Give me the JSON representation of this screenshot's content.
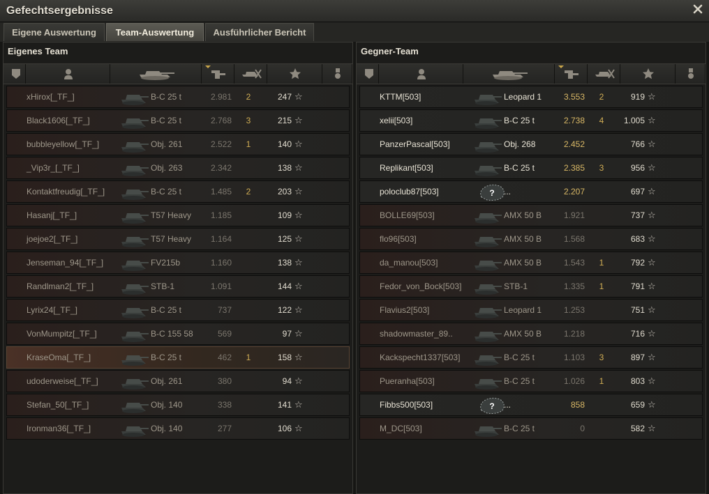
{
  "window": {
    "title": "Gefechtsergebnisse"
  },
  "tabs": [
    {
      "label": "Eigene Auswertung",
      "active": false
    },
    {
      "label": "Team-Auswertung",
      "active": true
    },
    {
      "label": "Ausführlicher Bericht",
      "active": false
    }
  ],
  "icons": {
    "close": "close-icon",
    "columns": [
      "platoon-icon",
      "player-icon",
      "tank-icon",
      "damage-icon",
      "kills-icon",
      "xp-star-icon",
      "medal-icon"
    ],
    "star": "☆",
    "unknown_vehicle": "?"
  },
  "colors": {
    "accent": "#d2ae55",
    "alive_text": "#e9e4d6",
    "dead_text": "#9e978a"
  },
  "own_team": {
    "title": "Eigenes Team",
    "rows": [
      {
        "player": "xHirox[_TF_]",
        "vehicle": "B-C 25 t",
        "damage": "2.981",
        "kills": "2",
        "xp": "247",
        "me": false
      },
      {
        "player": "Black1606[_TF_]",
        "vehicle": "B-C 25 t",
        "damage": "2.768",
        "kills": "3",
        "xp": "215",
        "me": false
      },
      {
        "player": "bubbleyellow[_TF_]",
        "vehicle": "Obj. 261",
        "damage": "2.522",
        "kills": "1",
        "xp": "140",
        "me": false
      },
      {
        "player": "_Vip3r_[_TF_]",
        "vehicle": "Obj. 263",
        "damage": "2.342",
        "kills": "",
        "xp": "138",
        "me": false
      },
      {
        "player": "Kontaktfreudig[_TF_]",
        "vehicle": "B-C 25 t",
        "damage": "1.485",
        "kills": "2",
        "xp": "203",
        "me": false
      },
      {
        "player": "Hasanj[_TF_]",
        "vehicle": "T57 Heavy",
        "damage": "1.185",
        "kills": "",
        "xp": "109",
        "me": false
      },
      {
        "player": "joejoe2[_TF_]",
        "vehicle": "T57 Heavy",
        "damage": "1.164",
        "kills": "",
        "xp": "125",
        "me": false
      },
      {
        "player": "Jenseman_94[_TF_]",
        "vehicle": "FV215b",
        "damage": "1.160",
        "kills": "",
        "xp": "138",
        "me": false
      },
      {
        "player": "Randlman2[_TF_]",
        "vehicle": "STB-1",
        "damage": "1.091",
        "kills": "",
        "xp": "144",
        "me": false
      },
      {
        "player": "Lyrix24[_TF_]",
        "vehicle": "B-C 25 t",
        "damage": "737",
        "kills": "",
        "xp": "122",
        "me": false
      },
      {
        "player": "VonMumpitz[_TF_]",
        "vehicle": "B-C 155 58",
        "damage": "569",
        "kills": "",
        "xp": "97",
        "me": false
      },
      {
        "player": "KraseOma[_TF_]",
        "vehicle": "B-C 25 t",
        "damage": "462",
        "kills": "1",
        "xp": "158",
        "me": true
      },
      {
        "player": "udoderweise[_TF_]",
        "vehicle": "Obj. 261",
        "damage": "380",
        "kills": "",
        "xp": "94",
        "me": false
      },
      {
        "player": "Stefan_50[_TF_]",
        "vehicle": "Obj. 140",
        "damage": "338",
        "kills": "",
        "xp": "141",
        "me": false
      },
      {
        "player": "Ironman36[_TF_]",
        "vehicle": "Obj. 140",
        "damage": "277",
        "kills": "",
        "xp": "106",
        "me": false
      }
    ]
  },
  "enemy_team": {
    "title": "Gegner-Team",
    "rows": [
      {
        "player": "KTTM[503]",
        "vehicle": "Leopard 1",
        "damage": "3.553",
        "kills": "2",
        "xp": "919",
        "alive": true,
        "unknown": false
      },
      {
        "player": "xelii[503]",
        "vehicle": "B-C 25 t",
        "damage": "2.738",
        "kills": "4",
        "xp": "1.005",
        "alive": true,
        "unknown": false
      },
      {
        "player": "PanzerPascal[503]",
        "vehicle": "Obj. 268",
        "damage": "2.452",
        "kills": "",
        "xp": "766",
        "alive": true,
        "unknown": false
      },
      {
        "player": "Replikant[503]",
        "vehicle": "B-C 25 t",
        "damage": "2.385",
        "kills": "3",
        "xp": "956",
        "alive": true,
        "unknown": false
      },
      {
        "player": "poloclub87[503]",
        "vehicle": "...",
        "damage": "2.207",
        "kills": "",
        "xp": "697",
        "alive": true,
        "unknown": true
      },
      {
        "player": "BOLLE69[503]",
        "vehicle": "AMX 50 B",
        "damage": "1.921",
        "kills": "",
        "xp": "737",
        "alive": false,
        "unknown": false
      },
      {
        "player": "flo96[503]",
        "vehicle": "AMX 50 B",
        "damage": "1.568",
        "kills": "",
        "xp": "683",
        "alive": false,
        "unknown": false
      },
      {
        "player": "da_manou[503]",
        "vehicle": "AMX 50 B",
        "damage": "1.543",
        "kills": "1",
        "xp": "792",
        "alive": false,
        "unknown": false
      },
      {
        "player": "Fedor_von_Bock[503]",
        "vehicle": "STB-1",
        "damage": "1.335",
        "kills": "1",
        "xp": "791",
        "alive": false,
        "unknown": false
      },
      {
        "player": "Flavius2[503]",
        "vehicle": "Leopard 1",
        "damage": "1.253",
        "kills": "",
        "xp": "751",
        "alive": false,
        "unknown": false
      },
      {
        "player": "shadowmaster_89..",
        "vehicle": "AMX 50 B",
        "damage": "1.218",
        "kills": "",
        "xp": "716",
        "alive": false,
        "unknown": false
      },
      {
        "player": "Kackspecht1337[503]",
        "vehicle": "B-C 25 t",
        "damage": "1.103",
        "kills": "3",
        "xp": "897",
        "alive": false,
        "unknown": false
      },
      {
        "player": "Pueranha[503]",
        "vehicle": "B-C 25 t",
        "damage": "1.026",
        "kills": "1",
        "xp": "803",
        "alive": false,
        "unknown": false
      },
      {
        "player": "Fibbs500[503]",
        "vehicle": "...",
        "damage": "858",
        "kills": "",
        "xp": "659",
        "alive": true,
        "unknown": true
      },
      {
        "player": "M_DC[503]",
        "vehicle": "B-C 25 t",
        "damage": "0",
        "kills": "",
        "xp": "582",
        "alive": false,
        "unknown": false
      }
    ]
  }
}
